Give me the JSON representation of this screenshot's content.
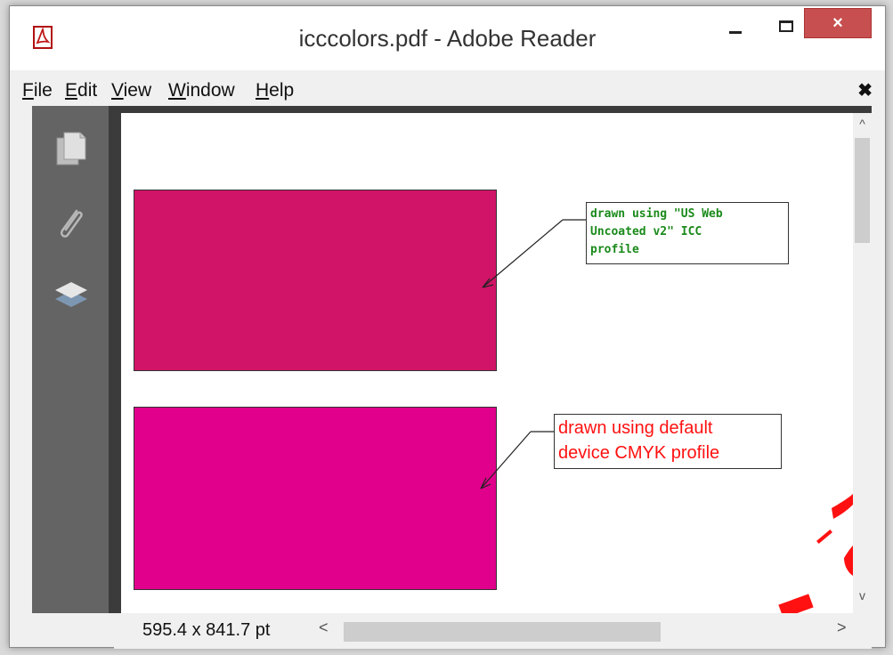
{
  "window": {
    "title": "icccolors.pdf - Adobe Reader",
    "close_glyph": "×",
    "app_icon": "adobe-pdf-icon"
  },
  "menu": {
    "items": [
      {
        "label": "File",
        "accel": "F",
        "rest": "ile"
      },
      {
        "label": "Edit",
        "accel": "E",
        "rest": "dit"
      },
      {
        "label": "View",
        "accel": "V",
        "rest": "iew"
      },
      {
        "label": "Window",
        "accel": "W",
        "rest": "indow"
      },
      {
        "label": "Help",
        "accel": "H",
        "rest": "elp"
      }
    ],
    "doc_close_glyph": "✖"
  },
  "navpane": {
    "icons": [
      "pages-icon",
      "attachment-icon",
      "layers-icon"
    ]
  },
  "document": {
    "rect1_color": "#d11467",
    "rect2_color": "#e0008b",
    "note1": {
      "lines": [
        "drawn using \"US Web",
        "Uncoated v2\" ICC",
        "profile"
      ],
      "color": "#1a8a1a"
    },
    "note2": {
      "lines": [
        "drawn using default",
        "device CMYK profile"
      ],
      "color": "#ff1111"
    }
  },
  "status": {
    "page_size": "595.4 x 841.7 pt",
    "scroll_left_glyph": "<",
    "scroll_right_glyph": ">"
  },
  "vscroll": {
    "up_glyph": "^",
    "down_glyph": "v"
  }
}
